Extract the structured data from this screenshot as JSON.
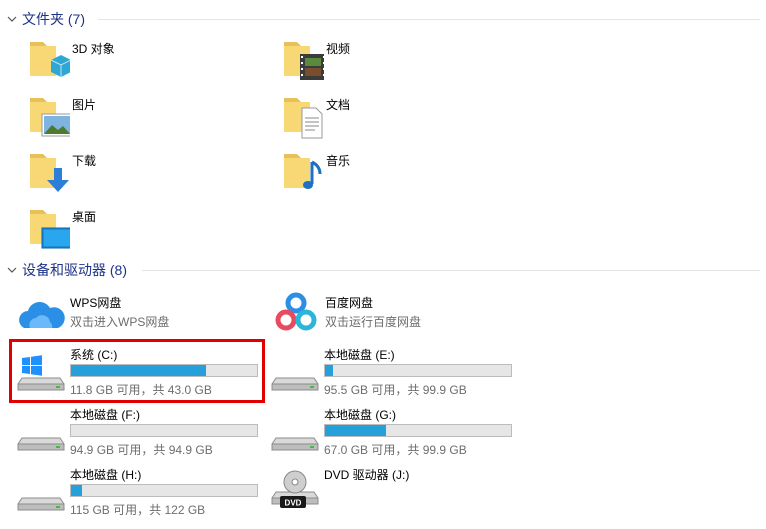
{
  "folders_group": {
    "title": "文件夹 (7)"
  },
  "folders": [
    {
      "name": "3D 对象",
      "icon": "3d-objects-folder-icon"
    },
    {
      "name": "视频",
      "icon": "videos-folder-icon"
    },
    {
      "name": "图片",
      "icon": "pictures-folder-icon"
    },
    {
      "name": "文档",
      "icon": "documents-folder-icon"
    },
    {
      "name": "下载",
      "icon": "downloads-folder-icon"
    },
    {
      "name": "音乐",
      "icon": "music-folder-icon"
    },
    {
      "name": "桌面",
      "icon": "desktop-folder-icon"
    }
  ],
  "devices_group": {
    "title": "设备和驱动器 (8)"
  },
  "devices": [
    {
      "name": "WPS网盘",
      "subtitle": "双击进入WPS网盘",
      "icon": "wps-cloud-icon"
    },
    {
      "name": "百度网盘",
      "subtitle": "双击运行百度网盘",
      "icon": "baidu-netdisk-icon"
    },
    {
      "name": "系统 (C:)",
      "space": "11.8 GB 可用，共 43.0 GB",
      "used_fraction": 0.726,
      "icon": "windows-drive-icon"
    },
    {
      "name": "本地磁盘 (E:)",
      "space": "95.5 GB 可用，共 99.9 GB",
      "used_fraction": 0.044,
      "icon": "hard-drive-icon"
    },
    {
      "name": "本地磁盘 (F:)",
      "space": "94.9 GB 可用，共 94.9 GB",
      "used_fraction": 0.0,
      "icon": "hard-drive-icon"
    },
    {
      "name": "本地磁盘 (G:)",
      "space": "67.0 GB 可用，共 99.9 GB",
      "used_fraction": 0.329,
      "icon": "hard-drive-icon"
    },
    {
      "name": "本地磁盘 (H:)",
      "space": "115 GB 可用，共 122 GB",
      "used_fraction": 0.057,
      "icon": "hard-drive-icon"
    },
    {
      "name": "DVD 驱动器 (J:)",
      "icon": "dvd-drive-icon"
    }
  ],
  "colors": {
    "bar_fill": "#26a0da",
    "group_title": "#1e3287",
    "highlight": "#e00000"
  }
}
